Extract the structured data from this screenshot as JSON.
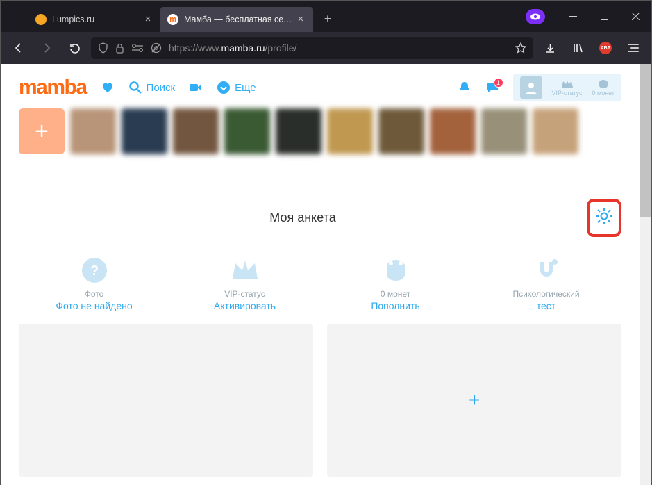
{
  "browser": {
    "tabs": [
      {
        "label": "Lumpics.ru",
        "favicon": "#f6a623"
      },
      {
        "label": "Мамба — бесплатная сеть зна",
        "favicon": "#ff6a13"
      }
    ],
    "url": {
      "prefix": "https://www.",
      "host": "mamba.ru",
      "path": "/profile/"
    }
  },
  "header": {
    "logo": "mamba",
    "search": "Поиск",
    "more": "Еще",
    "vip": "VIP-статус",
    "coins": "0 монет",
    "badge": "1"
  },
  "section": {
    "title": "Моя анкета"
  },
  "cards": {
    "photo": {
      "label": "Фото",
      "link": "Фото не найдено"
    },
    "vip": {
      "label": "VIP-статус",
      "link": "Активировать"
    },
    "coins": {
      "label": "0 монет",
      "link": "Пополнить"
    },
    "test": {
      "label": "Психологический",
      "link": "тест"
    }
  },
  "strip_colors": [
    "#b89478",
    "#2a3c52",
    "#73563f",
    "#3a5a33",
    "#2a2e2a",
    "#c09850",
    "#6e5a3a",
    "#a3623c",
    "#989078",
    "#c6a27a"
  ]
}
